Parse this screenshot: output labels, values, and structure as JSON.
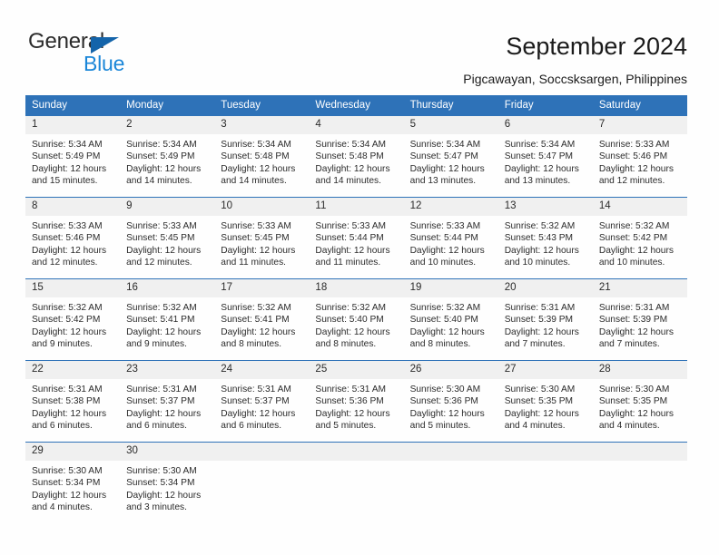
{
  "brand": {
    "name_top": "General",
    "name_bottom": "Blue",
    "accent_color": "#1464aa",
    "blue_text_color": "#1a86d8"
  },
  "header": {
    "title": "September 2024",
    "subtitle": "Pigcawayan, Soccsksargen, Philippines"
  },
  "theme": {
    "header_row_bg": "#2e72b8",
    "daynum_bg": "#f0f0f0",
    "row_divider": "#2e72b8",
    "text_color": "#2b2b2b"
  },
  "calendar": {
    "weekday_headers": [
      "Sunday",
      "Monday",
      "Tuesday",
      "Wednesday",
      "Thursday",
      "Friday",
      "Saturday"
    ],
    "weeks": [
      [
        {
          "day": "1",
          "sunrise": "Sunrise: 5:34 AM",
          "sunset": "Sunset: 5:49 PM",
          "daylight_line1": "Daylight: 12 hours",
          "daylight_line2": "and 15 minutes."
        },
        {
          "day": "2",
          "sunrise": "Sunrise: 5:34 AM",
          "sunset": "Sunset: 5:49 PM",
          "daylight_line1": "Daylight: 12 hours",
          "daylight_line2": "and 14 minutes."
        },
        {
          "day": "3",
          "sunrise": "Sunrise: 5:34 AM",
          "sunset": "Sunset: 5:48 PM",
          "daylight_line1": "Daylight: 12 hours",
          "daylight_line2": "and 14 minutes."
        },
        {
          "day": "4",
          "sunrise": "Sunrise: 5:34 AM",
          "sunset": "Sunset: 5:48 PM",
          "daylight_line1": "Daylight: 12 hours",
          "daylight_line2": "and 14 minutes."
        },
        {
          "day": "5",
          "sunrise": "Sunrise: 5:34 AM",
          "sunset": "Sunset: 5:47 PM",
          "daylight_line1": "Daylight: 12 hours",
          "daylight_line2": "and 13 minutes."
        },
        {
          "day": "6",
          "sunrise": "Sunrise: 5:34 AM",
          "sunset": "Sunset: 5:47 PM",
          "daylight_line1": "Daylight: 12 hours",
          "daylight_line2": "and 13 minutes."
        },
        {
          "day": "7",
          "sunrise": "Sunrise: 5:33 AM",
          "sunset": "Sunset: 5:46 PM",
          "daylight_line1": "Daylight: 12 hours",
          "daylight_line2": "and 12 minutes."
        }
      ],
      [
        {
          "day": "8",
          "sunrise": "Sunrise: 5:33 AM",
          "sunset": "Sunset: 5:46 PM",
          "daylight_line1": "Daylight: 12 hours",
          "daylight_line2": "and 12 minutes."
        },
        {
          "day": "9",
          "sunrise": "Sunrise: 5:33 AM",
          "sunset": "Sunset: 5:45 PM",
          "daylight_line1": "Daylight: 12 hours",
          "daylight_line2": "and 12 minutes."
        },
        {
          "day": "10",
          "sunrise": "Sunrise: 5:33 AM",
          "sunset": "Sunset: 5:45 PM",
          "daylight_line1": "Daylight: 12 hours",
          "daylight_line2": "and 11 minutes."
        },
        {
          "day": "11",
          "sunrise": "Sunrise: 5:33 AM",
          "sunset": "Sunset: 5:44 PM",
          "daylight_line1": "Daylight: 12 hours",
          "daylight_line2": "and 11 minutes."
        },
        {
          "day": "12",
          "sunrise": "Sunrise: 5:33 AM",
          "sunset": "Sunset: 5:44 PM",
          "daylight_line1": "Daylight: 12 hours",
          "daylight_line2": "and 10 minutes."
        },
        {
          "day": "13",
          "sunrise": "Sunrise: 5:32 AM",
          "sunset": "Sunset: 5:43 PM",
          "daylight_line1": "Daylight: 12 hours",
          "daylight_line2": "and 10 minutes."
        },
        {
          "day": "14",
          "sunrise": "Sunrise: 5:32 AM",
          "sunset": "Sunset: 5:42 PM",
          "daylight_line1": "Daylight: 12 hours",
          "daylight_line2": "and 10 minutes."
        }
      ],
      [
        {
          "day": "15",
          "sunrise": "Sunrise: 5:32 AM",
          "sunset": "Sunset: 5:42 PM",
          "daylight_line1": "Daylight: 12 hours",
          "daylight_line2": "and 9 minutes."
        },
        {
          "day": "16",
          "sunrise": "Sunrise: 5:32 AM",
          "sunset": "Sunset: 5:41 PM",
          "daylight_line1": "Daylight: 12 hours",
          "daylight_line2": "and 9 minutes."
        },
        {
          "day": "17",
          "sunrise": "Sunrise: 5:32 AM",
          "sunset": "Sunset: 5:41 PM",
          "daylight_line1": "Daylight: 12 hours",
          "daylight_line2": "and 8 minutes."
        },
        {
          "day": "18",
          "sunrise": "Sunrise: 5:32 AM",
          "sunset": "Sunset: 5:40 PM",
          "daylight_line1": "Daylight: 12 hours",
          "daylight_line2": "and 8 minutes."
        },
        {
          "day": "19",
          "sunrise": "Sunrise: 5:32 AM",
          "sunset": "Sunset: 5:40 PM",
          "daylight_line1": "Daylight: 12 hours",
          "daylight_line2": "and 8 minutes."
        },
        {
          "day": "20",
          "sunrise": "Sunrise: 5:31 AM",
          "sunset": "Sunset: 5:39 PM",
          "daylight_line1": "Daylight: 12 hours",
          "daylight_line2": "and 7 minutes."
        },
        {
          "day": "21",
          "sunrise": "Sunrise: 5:31 AM",
          "sunset": "Sunset: 5:39 PM",
          "daylight_line1": "Daylight: 12 hours",
          "daylight_line2": "and 7 minutes."
        }
      ],
      [
        {
          "day": "22",
          "sunrise": "Sunrise: 5:31 AM",
          "sunset": "Sunset: 5:38 PM",
          "daylight_line1": "Daylight: 12 hours",
          "daylight_line2": "and 6 minutes."
        },
        {
          "day": "23",
          "sunrise": "Sunrise: 5:31 AM",
          "sunset": "Sunset: 5:37 PM",
          "daylight_line1": "Daylight: 12 hours",
          "daylight_line2": "and 6 minutes."
        },
        {
          "day": "24",
          "sunrise": "Sunrise: 5:31 AM",
          "sunset": "Sunset: 5:37 PM",
          "daylight_line1": "Daylight: 12 hours",
          "daylight_line2": "and 6 minutes."
        },
        {
          "day": "25",
          "sunrise": "Sunrise: 5:31 AM",
          "sunset": "Sunset: 5:36 PM",
          "daylight_line1": "Daylight: 12 hours",
          "daylight_line2": "and 5 minutes."
        },
        {
          "day": "26",
          "sunrise": "Sunrise: 5:30 AM",
          "sunset": "Sunset: 5:36 PM",
          "daylight_line1": "Daylight: 12 hours",
          "daylight_line2": "and 5 minutes."
        },
        {
          "day": "27",
          "sunrise": "Sunrise: 5:30 AM",
          "sunset": "Sunset: 5:35 PM",
          "daylight_line1": "Daylight: 12 hours",
          "daylight_line2": "and 4 minutes."
        },
        {
          "day": "28",
          "sunrise": "Sunrise: 5:30 AM",
          "sunset": "Sunset: 5:35 PM",
          "daylight_line1": "Daylight: 12 hours",
          "daylight_line2": "and 4 minutes."
        }
      ],
      [
        {
          "day": "29",
          "sunrise": "Sunrise: 5:30 AM",
          "sunset": "Sunset: 5:34 PM",
          "daylight_line1": "Daylight: 12 hours",
          "daylight_line2": "and 4 minutes."
        },
        {
          "day": "30",
          "sunrise": "Sunrise: 5:30 AM",
          "sunset": "Sunset: 5:34 PM",
          "daylight_line1": "Daylight: 12 hours",
          "daylight_line2": "and 3 minutes."
        },
        {
          "day": "",
          "sunrise": "",
          "sunset": "",
          "daylight_line1": "",
          "daylight_line2": ""
        },
        {
          "day": "",
          "sunrise": "",
          "sunset": "",
          "daylight_line1": "",
          "daylight_line2": ""
        },
        {
          "day": "",
          "sunrise": "",
          "sunset": "",
          "daylight_line1": "",
          "daylight_line2": ""
        },
        {
          "day": "",
          "sunrise": "",
          "sunset": "",
          "daylight_line1": "",
          "daylight_line2": ""
        },
        {
          "day": "",
          "sunrise": "",
          "sunset": "",
          "daylight_line1": "",
          "daylight_line2": ""
        }
      ]
    ]
  }
}
